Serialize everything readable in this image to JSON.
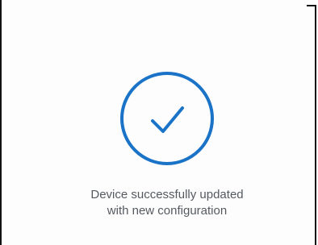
{
  "dialog": {
    "message_line1": "Device successfully updated",
    "message_line2": "with new configuration"
  },
  "icons": {
    "status_icon": "checkmark-circle-icon"
  },
  "colors": {
    "accent": "#1a73c7",
    "text": "#555a60",
    "background": "#fdfdfd"
  }
}
